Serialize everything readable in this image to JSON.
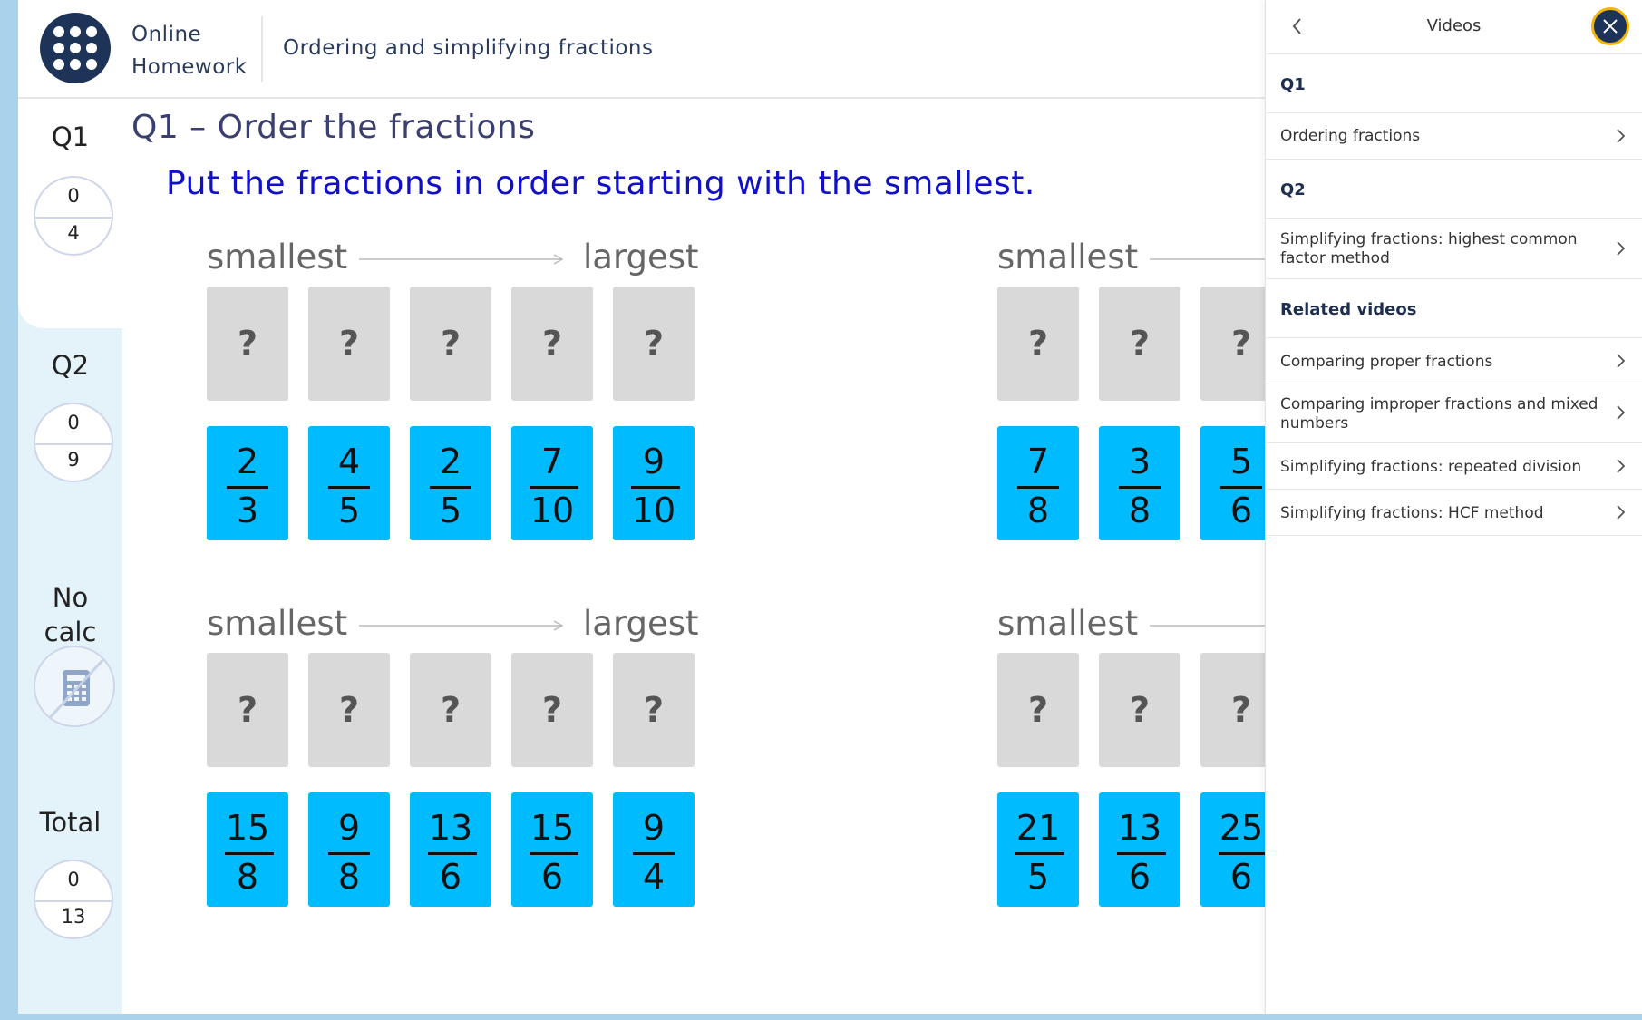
{
  "header": {
    "brand_line1": "Online",
    "brand_line2": "Homework",
    "topic": "Ordering and simplifying fractions"
  },
  "sidebar": {
    "q1": {
      "label": "Q1",
      "score": "0",
      "total": "4"
    },
    "q2": {
      "label": "Q2",
      "score": "0",
      "total": "9"
    },
    "calc": {
      "line1": "No",
      "line2": "calc",
      "icon": "no-calculator-icon"
    },
    "total": {
      "label": "Total",
      "score": "0",
      "total": "13"
    }
  },
  "main": {
    "title": "Q1 – Order the fractions",
    "instruction": "Put the fractions in order starting with the smallest.",
    "smallest_label": "smallest",
    "largest_label": "largest",
    "slot_placeholder": "?",
    "groups": [
      {
        "cards": [
          {
            "n": "2",
            "d": "3"
          },
          {
            "n": "4",
            "d": "5"
          },
          {
            "n": "2",
            "d": "5"
          },
          {
            "n": "7",
            "d": "10"
          },
          {
            "n": "9",
            "d": "10"
          }
        ]
      },
      {
        "cards": [
          {
            "n": "7",
            "d": "8"
          },
          {
            "n": "3",
            "d": "8"
          },
          {
            "n": "5",
            "d": "6"
          }
        ]
      },
      {
        "cards": [
          {
            "n": "15",
            "d": "8"
          },
          {
            "n": "9",
            "d": "8"
          },
          {
            "n": "13",
            "d": "6"
          },
          {
            "n": "15",
            "d": "6"
          },
          {
            "n": "9",
            "d": "4"
          }
        ]
      },
      {
        "cards": [
          {
            "n": "21",
            "d": "5"
          },
          {
            "n": "13",
            "d": "6"
          },
          {
            "n": "25",
            "d": "6"
          }
        ]
      }
    ]
  },
  "panel": {
    "title": "Videos",
    "sections": [
      {
        "heading": "Q1",
        "items": [
          "Ordering fractions"
        ]
      },
      {
        "heading": "Q2",
        "items": [
          "Simplifying fractions: highest common factor method"
        ]
      },
      {
        "heading": "Related videos",
        "items": [
          "Comparing proper fractions",
          "Comparing improper fractions and mixed numbers",
          "Simplifying fractions: repeated division",
          "Simplifying fractions: HCF method"
        ]
      }
    ]
  },
  "colors": {
    "navy": "#1e3358",
    "card_blue": "#00bcff",
    "slot_grey": "#d9d9d9",
    "instruction_blue": "#1010c8",
    "close_ring": "#f2b705"
  }
}
